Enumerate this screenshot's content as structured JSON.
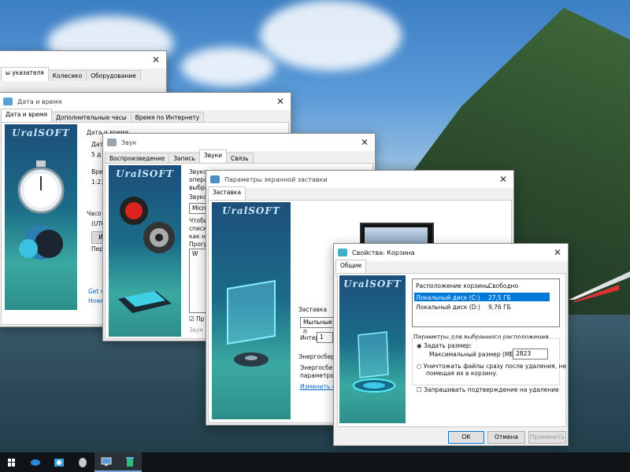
{
  "win_mouse": {
    "tabs": [
      "ы указателя",
      "Колесико",
      "Оборудование"
    ]
  },
  "win_datetime": {
    "title": "Дата и время",
    "tabs": [
      "Дата и время",
      "Дополнительные часы",
      "Время по Интернету"
    ],
    "brand": "UralSOFT",
    "labels": [
      "Дата и время",
      "Дата",
      "5 д",
      "Врем",
      "1:23",
      "Часо",
      "(UTC",
      "И",
      "Пере",
      "Get m",
      "Howe"
    ]
  },
  "win_sound": {
    "title": "Звук",
    "tabs": [
      "Воспроизведение",
      "Запись",
      "Звуки",
      "Связь"
    ],
    "brand": "UralSOFT",
    "labels": [
      "Звуко",
      "опера",
      "выбра",
      "Звуко",
      "Micros",
      "Чтобы",
      "списк",
      "как но",
      "Прогр",
      "W",
      "Пр",
      "Звук"
    ]
  },
  "win_saver": {
    "title": "Параметры экранной заставки",
    "tabs": [
      "Заставка"
    ],
    "brand": "UralSOFT",
    "section_saver": "Заставка",
    "saver_value": "Мыльные п",
    "interval_label": "Интер",
    "interval_value": "1",
    "power_title": "Энергосбере",
    "power_text1": "Энергосбере",
    "power_text2": "параметров",
    "power_link": "Изменить па"
  },
  "win_recycle": {
    "title": "Свойства: Корзина",
    "tabs": [
      "Общие"
    ],
    "brand": "UralSOFT",
    "col_location": "Расположение корзины",
    "col_free": "Свободно",
    "rows": [
      {
        "name": "Локальный диск (C:)",
        "free": "27,5 ГБ"
      },
      {
        "name": "Локальный диск (D:)",
        "free": "9,76 ГБ"
      }
    ],
    "group_title": "Параметры для выбранного расположения",
    "opt_custom": "Задать размер:",
    "max_size_label": "Максимальный размер (МБ):",
    "max_size_value": "2823",
    "opt_delete_line1": "Уничтожать файлы сразу после удаления, не",
    "opt_delete_line2": "помещая их в корзину.",
    "confirm_label": "Запрашивать подтверждение на удаление",
    "ok": "ОК",
    "cancel": "Отмена",
    "apply": "Применить"
  },
  "taskbar": {
    "icons": [
      "start-icon",
      "mouse-icon",
      "datetime-icon",
      "sound-icon",
      "screensaver-icon",
      "recycle-bin-icon"
    ]
  },
  "colors": {
    "accent": "#0078d7",
    "selection": "#0078d7",
    "taskbar": "#101418"
  }
}
